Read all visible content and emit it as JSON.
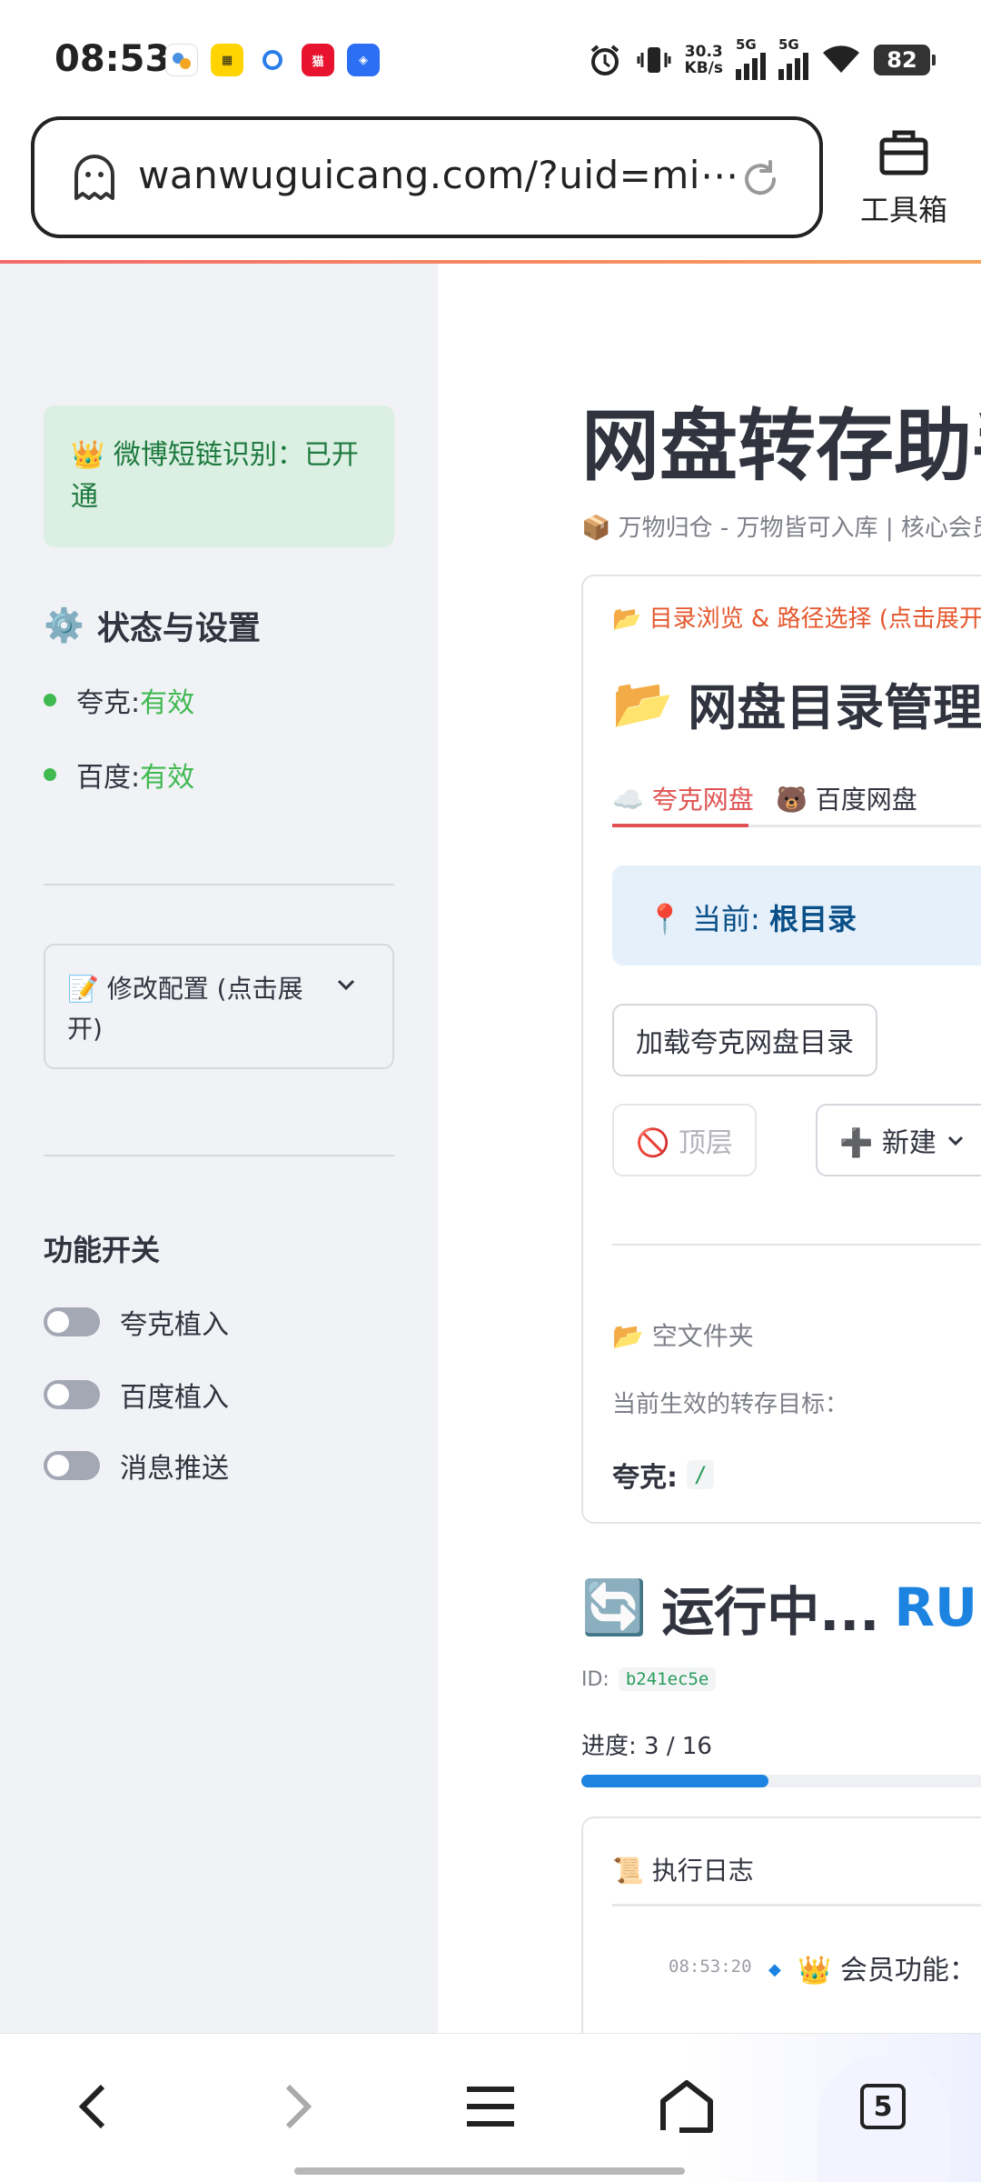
{
  "status_bar": {
    "time": "08:53",
    "net_speed_value": "30.3",
    "net_speed_unit": "KB/s",
    "signal1_label": "5G",
    "signal2_label": "5G",
    "battery": "82"
  },
  "browser": {
    "url": "wanwuguicang.com/?uid=mi⋯",
    "toolbox_label": "工具箱"
  },
  "sidebar": {
    "alert_text": "👑 微博短链识别：已开通",
    "settings_heading": "状态与设置",
    "status": [
      {
        "name": "夸克: ",
        "value": "有效"
      },
      {
        "name": "百度: ",
        "value": "有效"
      }
    ],
    "config_expander": "📝 修改配置 (点击展开)",
    "features_heading": "功能开关",
    "toggles": [
      {
        "label": "夸克植入",
        "on": false
      },
      {
        "label": "百度植入",
        "on": false
      },
      {
        "label": "消息推送",
        "on": false
      }
    ]
  },
  "main": {
    "title": "网盘转存助手",
    "caption": "📦 万物归仓 - 万物皆可入库 | 核心会员",
    "card": {
      "expander_label": "📂 目录浏览 & 路径选择 (点击展开)",
      "heading": "网盘目录管理",
      "tabs": [
        {
          "label": "☁️ 夸克网盘",
          "active": true
        },
        {
          "label": "🐻 百度网盘",
          "active": false
        }
      ],
      "current_prefix": "📍 当前: ",
      "current_value": "根目录",
      "load_button": "加载夸克网盘目录",
      "top_button": "🚫 顶层",
      "new_button": "➕ 新建",
      "empty_folder": "📂 空文件夹",
      "target_label": "当前生效的转存目标：",
      "target_name": "夸克:",
      "target_path": "/"
    },
    "run": {
      "heading": "运行中...",
      "state": "RUNNING",
      "id_label": "ID:",
      "id_value": "b241ec5e",
      "progress_label": "进度: 3 / 16",
      "progress_fraction": 0.1875
    },
    "log": {
      "title": "📜 执行日志",
      "entries": [
        {
          "time": "08:53:20",
          "text": "👑 会员功能："
        }
      ]
    }
  },
  "bottom_nav": {
    "tab_count": "5"
  },
  "colors": {
    "accent_red": "#e05252",
    "success_green": "#3fb950",
    "primary_blue": "#1c83e1",
    "sidebar_bg": "#f0f2f6"
  }
}
